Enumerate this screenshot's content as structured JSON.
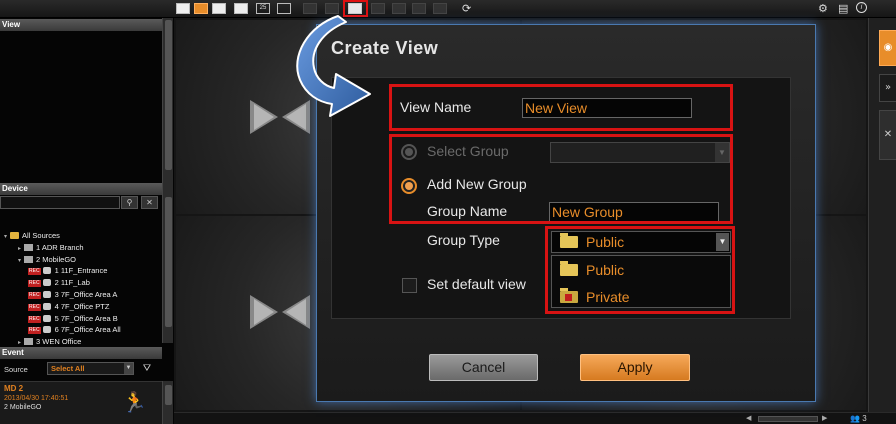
{
  "toolbar": {
    "layout_buttons": [
      "layout-1x1",
      "layout-2x2",
      "layout-3x3",
      "layout-4x4",
      "layout-25",
      "layout-multi"
    ],
    "active_layout": "layout-2x2",
    "highlighted_button": "create-view-button",
    "layout_25_label": "25"
  },
  "left_panel": {
    "view_header": "View",
    "device_header": "Device",
    "device_tree": [
      {
        "label": "All Sources",
        "kind": "folder",
        "indent": 0
      },
      {
        "label": "1 ADR Branch",
        "kind": "dvr",
        "indent": 1
      },
      {
        "label": "2 MobileGO",
        "kind": "dvr",
        "indent": 1
      },
      {
        "label": "1  11F_Entrance",
        "kind": "camera",
        "indent": 2
      },
      {
        "label": "2  11F_Lab",
        "kind": "camera",
        "indent": 2
      },
      {
        "label": "3  7F_Office  Area  A",
        "kind": "camera",
        "indent": 2
      },
      {
        "label": "4  7F_Office  PTZ",
        "kind": "camera",
        "indent": 2
      },
      {
        "label": "5  7F_Office  Area  B",
        "kind": "camera",
        "indent": 2
      },
      {
        "label": "6  7F_Office  Area  All",
        "kind": "camera",
        "indent": 2
      },
      {
        "label": "3 WEN Office",
        "kind": "dvr",
        "indent": 1
      }
    ],
    "rec_badge": "REC",
    "event_header": "Event",
    "event_source_label": "Source",
    "event_source_value": "Select All",
    "event": {
      "title": "MD 2",
      "time": "2013/04/30 17:40:51",
      "source": "2 MobileGO"
    }
  },
  "dialog": {
    "title": "Create View",
    "view_name_label": "View Name",
    "view_name_value": "New View",
    "select_group_label": "Select Group",
    "add_new_group_label": "Add New Group",
    "group_name_label": "Group Name",
    "group_name_value": "New Group",
    "group_type_label": "Group Type",
    "group_type_selected": "Public",
    "group_type_options": [
      "Public",
      "Private"
    ],
    "set_default_label": "Set default view",
    "cancel_label": "Cancel",
    "apply_label": "Apply",
    "selected_radio": "add_new_group",
    "set_default_checked": false
  },
  "status": {
    "user_count": "3"
  },
  "colors": {
    "accent": "#e88d2a",
    "highlight_red": "#d81313",
    "dialog_border": "#4a79b0",
    "arrow_blue": "#3d6fb5"
  }
}
